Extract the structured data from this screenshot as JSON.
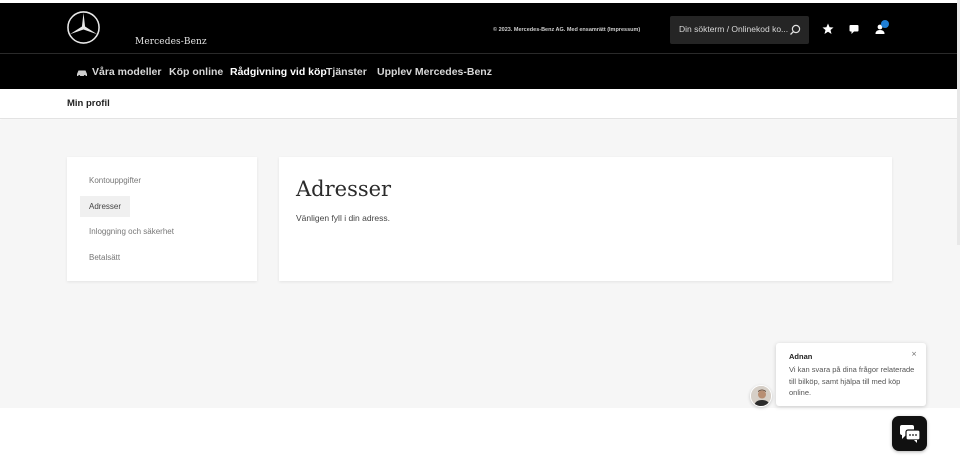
{
  "brand": {
    "name": "Mercedes-Benz"
  },
  "header": {
    "copyright": "© 2023. Mercedes-Benz AG. Med ensamrätt (Impressum)",
    "search_placeholder": "Din sökterm / Onlinekod ko...",
    "icons": [
      "search-icon",
      "star-icon",
      "chat-icon",
      "user-icon"
    ],
    "user_badge_color": "#1f7fd6"
  },
  "nav": {
    "items": [
      {
        "label": "Våra modeller",
        "icon": "car-icon"
      },
      {
        "label": "Köp online"
      },
      {
        "label": "Rådgivning vid köp",
        "active": true
      },
      {
        "label": "Tjänster"
      },
      {
        "label": "Upplev Mercedes-Benz"
      }
    ]
  },
  "subheader": {
    "title": "Min profil"
  },
  "sidebar": {
    "items": [
      {
        "label": "Kontouppgifter"
      },
      {
        "label": "Adresser",
        "active": true
      },
      {
        "label": "Inloggning och säkerhet"
      },
      {
        "label": "Betalsätt"
      }
    ]
  },
  "content": {
    "title": "Adresser",
    "subtitle": "Vänligen fyll i din adress."
  },
  "chat": {
    "agent_name": "Adnan",
    "message": "Vi kan svara på dina frågor relaterade till bilköp, samt hjälpa till med köp online.",
    "close_glyph": "×"
  }
}
